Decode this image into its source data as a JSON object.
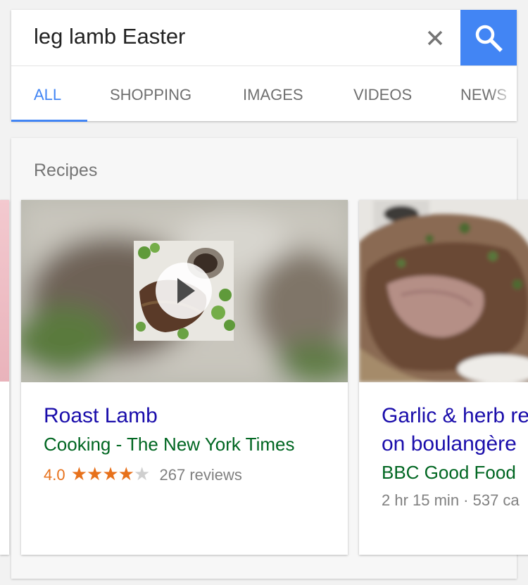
{
  "search": {
    "query": "leg lamb Easter"
  },
  "tabs": [
    {
      "label": "ALL",
      "active": true
    },
    {
      "label": "SHOPPING",
      "active": false
    },
    {
      "label": "IMAGES",
      "active": false
    },
    {
      "label": "VIDEOS",
      "active": false
    },
    {
      "label": "NEWS",
      "active": false
    }
  ],
  "recipes": {
    "title": "Recipes",
    "cards": [
      {
        "title": "Roast Lamb",
        "source": "Cooking - The New York Times",
        "rating": "4.0",
        "stars_filled": 4,
        "stars_total": 5,
        "reviews": "267 reviews",
        "has_video": true
      },
      {
        "title_line1": "Garlic & herb re",
        "title_line2": "on boulangère",
        "source": "BBC Good Food",
        "meta": "2 hr 15 min · 537 ca"
      }
    ]
  },
  "colors": {
    "accent": "#4285f4",
    "link": "#1a0dab",
    "source": "#006621",
    "rating": "#e7711b"
  }
}
